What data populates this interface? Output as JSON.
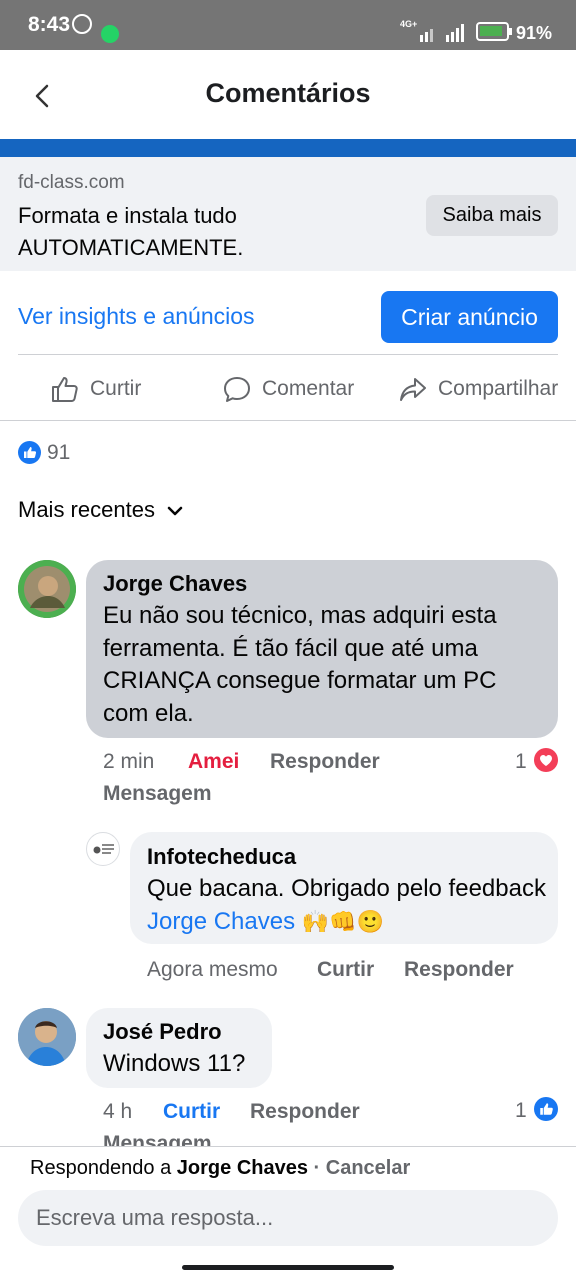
{
  "status_bar": {
    "time": "8:43",
    "network": "4G+",
    "battery": "91%"
  },
  "header": {
    "title": "Comentários"
  },
  "ad": {
    "domain": "fd-class.com",
    "headline": "Formata e instala tudo AUTOMATICAMENTE.",
    "cta": "Saiba mais"
  },
  "promo": {
    "insights_label": "Ver insights e anúncios",
    "create_ad_label": "Criar anúncio"
  },
  "actions": {
    "like": "Curtir",
    "comment": "Comentar",
    "share": "Compartilhar"
  },
  "reactions": {
    "count": "91"
  },
  "sort": {
    "label": "Mais recentes"
  },
  "comments": [
    {
      "name": "Jorge Chaves",
      "text": "Eu não sou técnico,  mas adquiri esta ferramenta. É tão fácil que até uma CRIANÇA consegue formatar um PC com ela.",
      "time": "2 min",
      "reaction_label": "Amei",
      "reply_label": "Responder",
      "message_label": "Mensagem",
      "reaction_count": "1",
      "colors": {
        "reaction_label": "#e41e3f",
        "badge": "#f33e58"
      }
    },
    {
      "name": "Infotecheduca",
      "text_before": "Que bacana. Obrigado pelo feedback ",
      "mention": "Jorge Chaves",
      "emoji": "🙌👊🙂",
      "time": "Agora mesmo",
      "like_label": "Curtir",
      "reply_label": "Responder"
    },
    {
      "name": "José Pedro",
      "text": "Windows 11?",
      "time": "4 h",
      "like_label": "Curtir",
      "reply_label": "Responder",
      "message_label": "Mensagem",
      "reaction_count": "1"
    }
  ],
  "compose": {
    "replying_prefix": "Respondendo a ",
    "replying_name": "Jorge Chaves",
    "separator": " · ",
    "cancel": "Cancelar",
    "placeholder": "Escreva uma resposta..."
  }
}
